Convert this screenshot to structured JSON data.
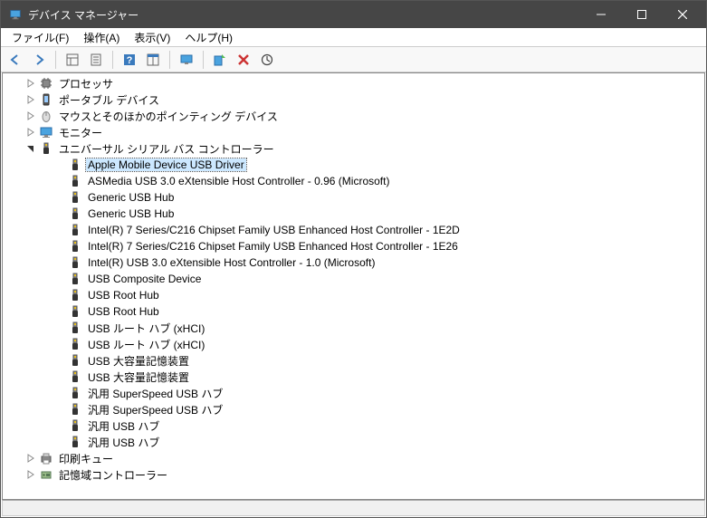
{
  "title": "デバイス マネージャー",
  "menu": {
    "file": "ファイル(F)",
    "action": "操作(A)",
    "view": "表示(V)",
    "help": "ヘルプ(H)"
  },
  "toolbar": {
    "back": "戻る",
    "forward": "進む",
    "view_large": "表示",
    "properties": "プロパティ",
    "help": "ヘルプ",
    "columns": "列",
    "monitor": "モニター",
    "scan": "ハードウェア変更のスキャン",
    "remove": "削除",
    "update": "更新"
  },
  "tree": {
    "categories": [
      {
        "label": "プロセッサ",
        "icon": "cpu",
        "expanded": false,
        "children": []
      },
      {
        "label": "ポータブル デバイス",
        "icon": "portable",
        "expanded": false,
        "children": []
      },
      {
        "label": "マウスとそのほかのポインティング デバイス",
        "icon": "mouse",
        "expanded": false,
        "children": []
      },
      {
        "label": "モニター",
        "icon": "monitor",
        "expanded": false,
        "children": []
      },
      {
        "label": "ユニバーサル シリアル バス コントローラー",
        "icon": "usb",
        "expanded": true,
        "children": [
          {
            "label": "Apple Mobile Device USB Driver",
            "selected": true
          },
          {
            "label": "ASMedia USB 3.0 eXtensible Host Controller - 0.96 (Microsoft)"
          },
          {
            "label": "Generic USB Hub"
          },
          {
            "label": "Generic USB Hub"
          },
          {
            "label": "Intel(R) 7 Series/C216 Chipset Family USB Enhanced Host Controller - 1E2D"
          },
          {
            "label": "Intel(R) 7 Series/C216 Chipset Family USB Enhanced Host Controller - 1E26"
          },
          {
            "label": "Intel(R) USB 3.0 eXtensible Host Controller - 1.0 (Microsoft)"
          },
          {
            "label": "USB Composite Device"
          },
          {
            "label": "USB Root Hub"
          },
          {
            "label": "USB Root Hub"
          },
          {
            "label": "USB ルート ハブ (xHCI)"
          },
          {
            "label": "USB ルート ハブ (xHCI)"
          },
          {
            "label": "USB 大容量記憶装置"
          },
          {
            "label": "USB 大容量記憶装置"
          },
          {
            "label": "汎用 SuperSpeed USB ハブ"
          },
          {
            "label": "汎用 SuperSpeed USB ハブ"
          },
          {
            "label": "汎用 USB ハブ"
          },
          {
            "label": "汎用 USB ハブ"
          }
        ]
      },
      {
        "label": "印刷キュー",
        "icon": "printer",
        "expanded": false,
        "children": []
      },
      {
        "label": "記憶域コントローラー",
        "icon": "storage",
        "expanded": false,
        "children": []
      }
    ]
  }
}
